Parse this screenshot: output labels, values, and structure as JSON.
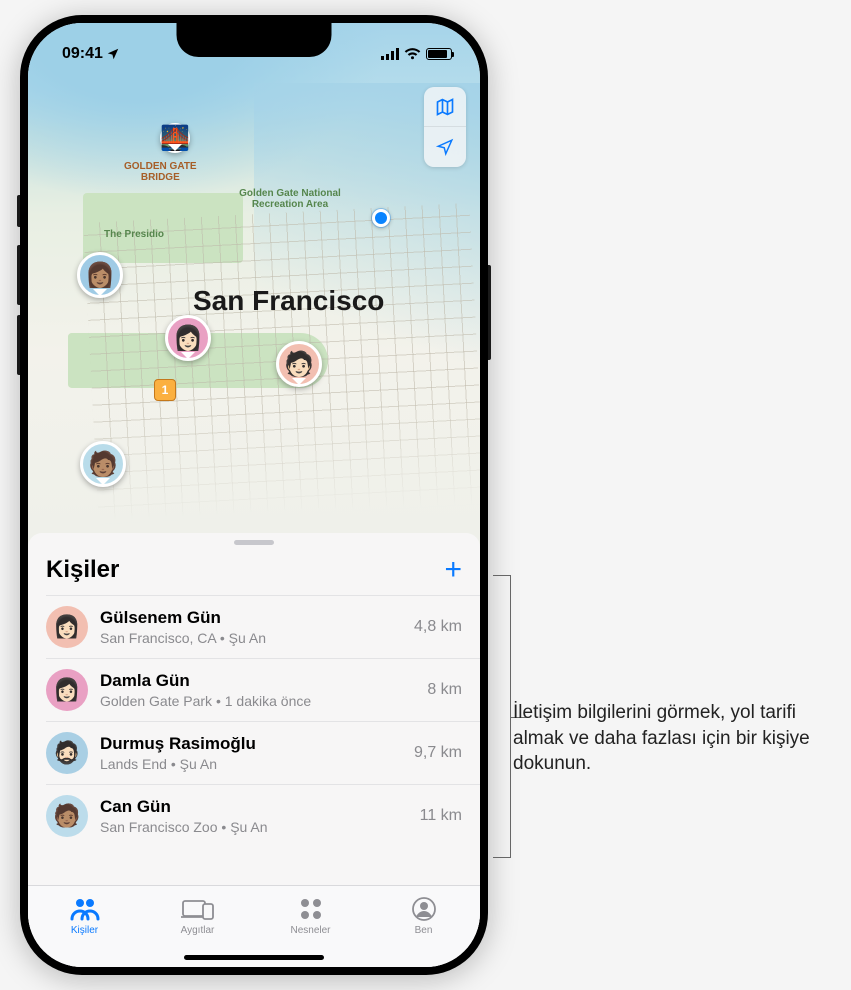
{
  "status": {
    "time": "09:41",
    "location_arrow": "▸"
  },
  "map": {
    "city_label": "San Francisco",
    "poi": {
      "golden_gate_bridge": "GOLDEN GATE\nBRIDGE",
      "ggnra": "Golden Gate National Recreation Area",
      "presidio": "The Presidio",
      "route1": "1"
    },
    "pins": [
      {
        "id": "bridge",
        "color": "#d5483f"
      },
      {
        "id": "person-a",
        "color": "#9fcbe5"
      },
      {
        "id": "person-b",
        "color": "#e9a0c3"
      },
      {
        "id": "person-c",
        "color": "#f2bfb1"
      },
      {
        "id": "person-d",
        "color": "#b9dcea"
      }
    ]
  },
  "sheet": {
    "title": "Kişiler",
    "add_symbol": "+"
  },
  "people": [
    {
      "name": "Gülsenem Gün",
      "location": "San Francisco, CA",
      "sep": " • ",
      "time": "Şu An",
      "distance": "4,8 km",
      "avatar_bg": "#f2bfb1"
    },
    {
      "name": "Damla Gün",
      "location": "Golden Gate Park",
      "sep": " • ",
      "time": "1 dakika önce",
      "distance": "8 km",
      "avatar_bg": "#e9a0c3"
    },
    {
      "name": "Durmuş Rasimoğlu",
      "location": "Lands End",
      "sep": " • ",
      "time": "Şu An",
      "distance": "9,7 km",
      "avatar_bg": "#a9cfe4"
    },
    {
      "name": "Can Gün",
      "location": "San Francisco Zoo",
      "sep": " • ",
      "time": "Şu An",
      "distance": "11 km",
      "avatar_bg": "#bcdceb"
    }
  ],
  "tabs": {
    "people": "Kişiler",
    "devices": "Aygıtlar",
    "items": "Nesneler",
    "me": "Ben"
  },
  "callout": {
    "text": "İletişim bilgilerini görmek, yol tarifi almak ve daha fazlası için bir kişiye dokunun."
  }
}
